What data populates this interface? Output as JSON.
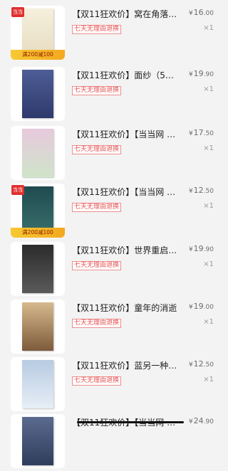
{
  "order_items": [
    {
      "title": "【双11狂欢价】窝在角落好…",
      "price_int": "16",
      "price_dec": ".00",
      "currency": "¥",
      "qty": "×1",
      "tag": "七天无理由退换",
      "promo": "满200减100",
      "promo_logo": "当当",
      "cover_colors": [
        "#f5efdc",
        "#e6dcc0"
      ]
    },
    {
      "title": "【双11狂欢价】面纱（50…",
      "price_int": "19",
      "price_dec": ".90",
      "currency": "¥",
      "qty": "×1",
      "tag": "七天无理由退换",
      "cover_colors": [
        "#4e5d96",
        "#2e3a6b"
      ]
    },
    {
      "title": "【双11狂欢价】【当当网 正…",
      "price_int": "17",
      "price_dec": ".50",
      "currency": "¥",
      "qty": "×1",
      "tag": "七天无理由退换",
      "cover_colors": [
        "#e7c9dd",
        "#cfe4c9"
      ]
    },
    {
      "title": "【双11狂欢价】【当当网 正…",
      "price_int": "12",
      "price_dec": ".50",
      "currency": "¥",
      "qty": "×1",
      "tag": "七天无理由退换",
      "promo": "满200减100",
      "promo_logo": "当当",
      "cover_colors": [
        "#1f4b4f",
        "#3a6f6d"
      ]
    },
    {
      "title": "【双11狂欢价】世界重启：…",
      "price_int": "19",
      "price_dec": ".90",
      "currency": "¥",
      "qty": "×1",
      "tag": "七天无理由退换",
      "cover_colors": [
        "#2b2b2b",
        "#5a5a5a"
      ]
    },
    {
      "title": "【双11狂欢价】童年的消逝",
      "price_int": "19",
      "price_dec": ".00",
      "currency": "¥",
      "qty": "×1",
      "tag": "七天无理由退换",
      "cover_colors": [
        "#d7b98d",
        "#7d5b3b"
      ]
    },
    {
      "title": "【双11狂欢价】蓝另一种…",
      "price_int": "12",
      "price_dec": ".50",
      "currency": "¥",
      "qty": "×1",
      "tag": "七天无理由退换",
      "cover_colors": [
        "#b7cbe2",
        "#e7eef6"
      ]
    },
    {
      "title": "【双11狂欢价】【当当网 …",
      "price_int": "24",
      "price_dec": ".90",
      "currency": "¥",
      "qty": "",
      "tag": "",
      "cover_colors": [
        "#5b6b8f",
        "#2f3d5c"
      ]
    }
  ]
}
